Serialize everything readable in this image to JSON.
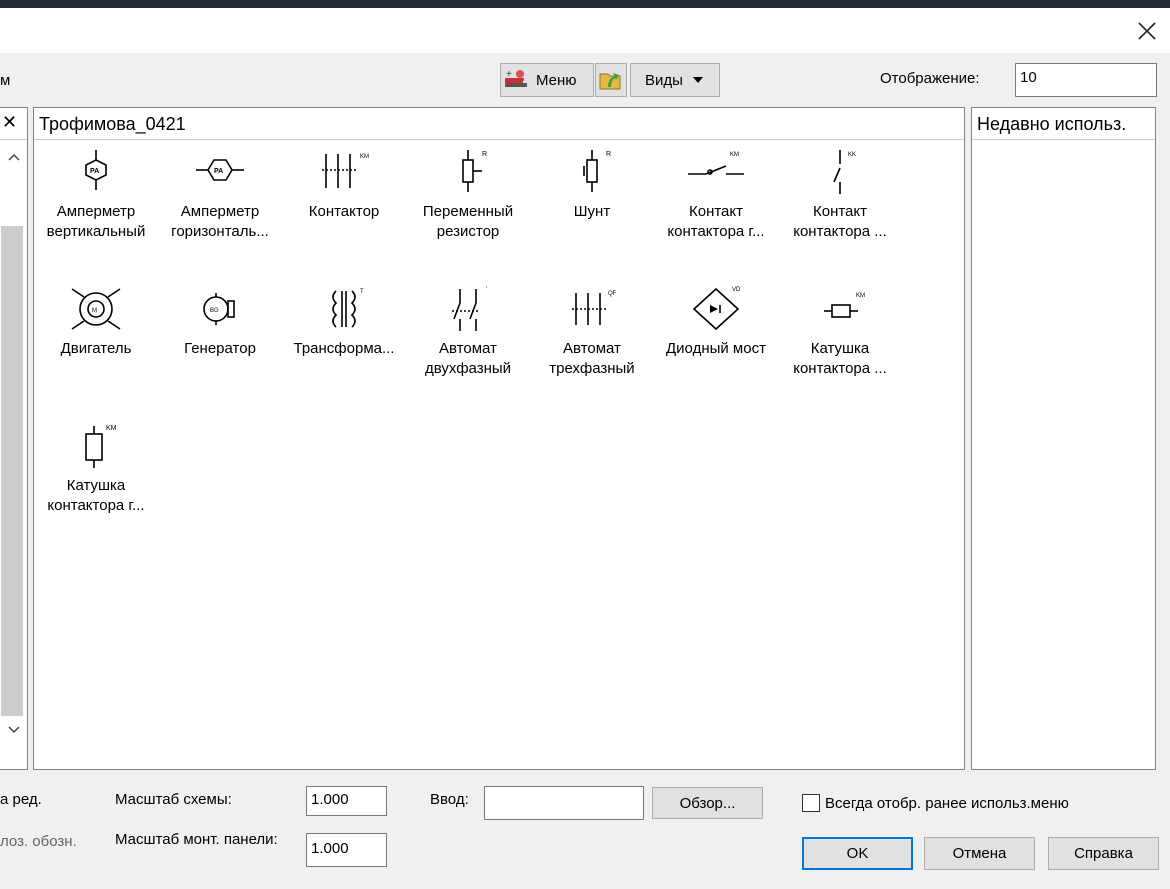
{
  "header": {
    "clipped_label": "м",
    "menu_label": "Меню",
    "views_label": "Виды",
    "display_label": "Отображение:",
    "display_value": "10"
  },
  "left_panel": {
    "close_glyph": "✕"
  },
  "library": {
    "title": "Трофимова_0421",
    "items": [
      {
        "icon": "ammeter-vertical-icon",
        "line1": "Амперметр",
        "line2": "вертикальный",
        "tag": "PA"
      },
      {
        "icon": "ammeter-horizontal-icon",
        "line1": "Амперметр",
        "line2": "горизонталь...",
        "tag": "PA"
      },
      {
        "icon": "contactor-icon",
        "line1": "Контактор",
        "line2": "",
        "tag": "KM"
      },
      {
        "icon": "variable-resistor-icon",
        "line1": "Переменный",
        "line2": "резистор",
        "tag": "R"
      },
      {
        "icon": "shunt-icon",
        "line1": "Шунт",
        "line2": "",
        "tag": "R"
      },
      {
        "icon": "contactor-contact-h-icon",
        "line1": "Контакт",
        "line2": "контактора г...",
        "tag": "KM"
      },
      {
        "icon": "contactor-contact-v-icon",
        "line1": "Контакт",
        "line2": "контактора ...",
        "tag": "KM"
      },
      {
        "icon": "motor-icon",
        "line1": "Двигатель",
        "line2": "",
        "tag": "M"
      },
      {
        "icon": "generator-icon",
        "line1": "Генератор",
        "line2": "",
        "tag": "BG"
      },
      {
        "icon": "transformer-icon",
        "line1": "Трансформа...",
        "line2": "",
        "tag": "T"
      },
      {
        "icon": "breaker-2phase-icon",
        "line1": "Автомат",
        "line2": "двухфазный",
        "tag": "QF"
      },
      {
        "icon": "breaker-3phase-icon",
        "line1": "Автомат",
        "line2": "трехфазный",
        "tag": "QF"
      },
      {
        "icon": "diode-bridge-icon",
        "line1": "Диодный мост",
        "line2": "",
        "tag": "VD"
      },
      {
        "icon": "contactor-coil-icon",
        "line1": "Катушка",
        "line2": "контактора ...",
        "tag": "KM"
      },
      {
        "icon": "contactor-coil-v-icon",
        "line1": "Катушка",
        "line2": "контактора г...",
        "tag": "KM"
      }
    ]
  },
  "recent": {
    "title": "Недавно использ."
  },
  "footer": {
    "left_clip1": "а ред.",
    "left_clip2": "лоз. обозн.",
    "scheme_scale_label": "Масштаб схемы:",
    "scheme_scale_value": "1.000",
    "panel_scale_label": "Масштаб монт. панели:",
    "panel_scale_value": "1.000",
    "input_label": "Ввод:",
    "input_value": "",
    "browse_label": "Обзор...",
    "always_show_label": "Всегда отобр. ранее использ.меню",
    "ok_label": "OK",
    "cancel_label": "Отмена",
    "help_label": "Справка"
  }
}
